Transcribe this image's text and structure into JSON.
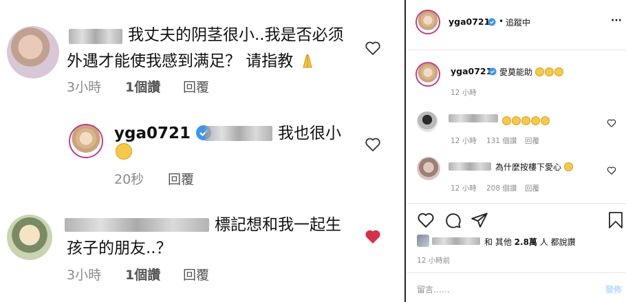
{
  "left_panel": {
    "comment1": {
      "text_line1": "我丈夫的阴茎很小..我是否必须",
      "text_line2": "外遇才能使我感到满足？ 请指教",
      "time": "3小時",
      "likes": "1個讚",
      "reply": "回覆"
    },
    "reply1": {
      "username": "yga0721",
      "text": "我也很小",
      "time": "20秒",
      "reply": "回覆"
    },
    "comment2": {
      "text_line1": "標記想和我一起生",
      "text_line2": "孩子的朋友..？",
      "time": "3小時",
      "likes": "1個讚",
      "reply": "回覆"
    }
  },
  "right_panel": {
    "header": {
      "username": "yga0721",
      "follow_status": "追蹤中",
      "separator": "•",
      "more": "···"
    },
    "caption": {
      "username": "yga0721",
      "text": "愛莫能助",
      "time": "12 小時"
    },
    "comment1": {
      "time": "12 小時",
      "likes": "131 個讚",
      "reply": "回覆"
    },
    "comment2": {
      "text": "為什麼按樓下愛心",
      "time": "12 小時",
      "likes": "208 個讚",
      "reply": "回覆"
    },
    "likes_line": {
      "prefix": "和 其他",
      "count": "2.8萬",
      "suffix": "人 都說讚"
    },
    "post_time": "12 小時前",
    "comment_input": {
      "placeholder": "留言……",
      "post_button": "發佈"
    },
    "colors": {
      "verified": "#3897f0",
      "heart_red": "#d6304b",
      "post_button": "#b3dbff"
    }
  }
}
